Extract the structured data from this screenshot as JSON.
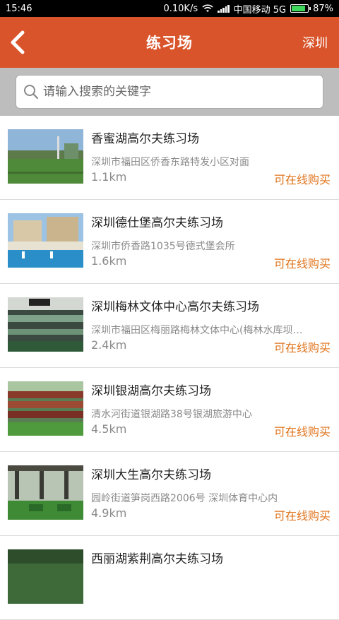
{
  "status_bar": {
    "time": "15:46",
    "speed": "0.10K/s",
    "carrier": "中国移动 5G",
    "battery_percent": "87%",
    "battery_level": 0.87
  },
  "header": {
    "title": "练习场",
    "city": "深圳",
    "background_color": "#d9542b"
  },
  "search": {
    "placeholder": "请输入搜索的关键字",
    "value": ""
  },
  "venues": [
    {
      "name": "香蜜湖高尔夫练习场",
      "address": "深圳市福田区侨香东路特发小区对面",
      "distance": "1.1km",
      "action": "可在线购买"
    },
    {
      "name": "深圳德仕堡高尔夫练习场",
      "address": "深圳市侨香路1035号德式堡会所",
      "distance": "1.6km",
      "action": "可在线购买"
    },
    {
      "name": "深圳梅林文体中心高尔夫练习场",
      "address": "深圳市福田区梅丽路梅林文体中心(梅林水库坝…",
      "distance": "2.4km",
      "action": "可在线购买"
    },
    {
      "name": "深圳银湖高尔夫练习场",
      "address": "清水河街道银湖路38号银湖旅游中心",
      "distance": "4.5km",
      "action": "可在线购买"
    },
    {
      "name": "深圳大生高尔夫练习场",
      "address": "园岭街道笋岗西路2006号 深圳体育中心内",
      "distance": "4.9km",
      "action": "可在线购买"
    },
    {
      "name": "西丽湖紫荆高尔夫练习场",
      "address": "",
      "distance": "",
      "action": ""
    }
  ],
  "colors": {
    "accent": "#d9542b",
    "buy_text": "#e0731b"
  }
}
